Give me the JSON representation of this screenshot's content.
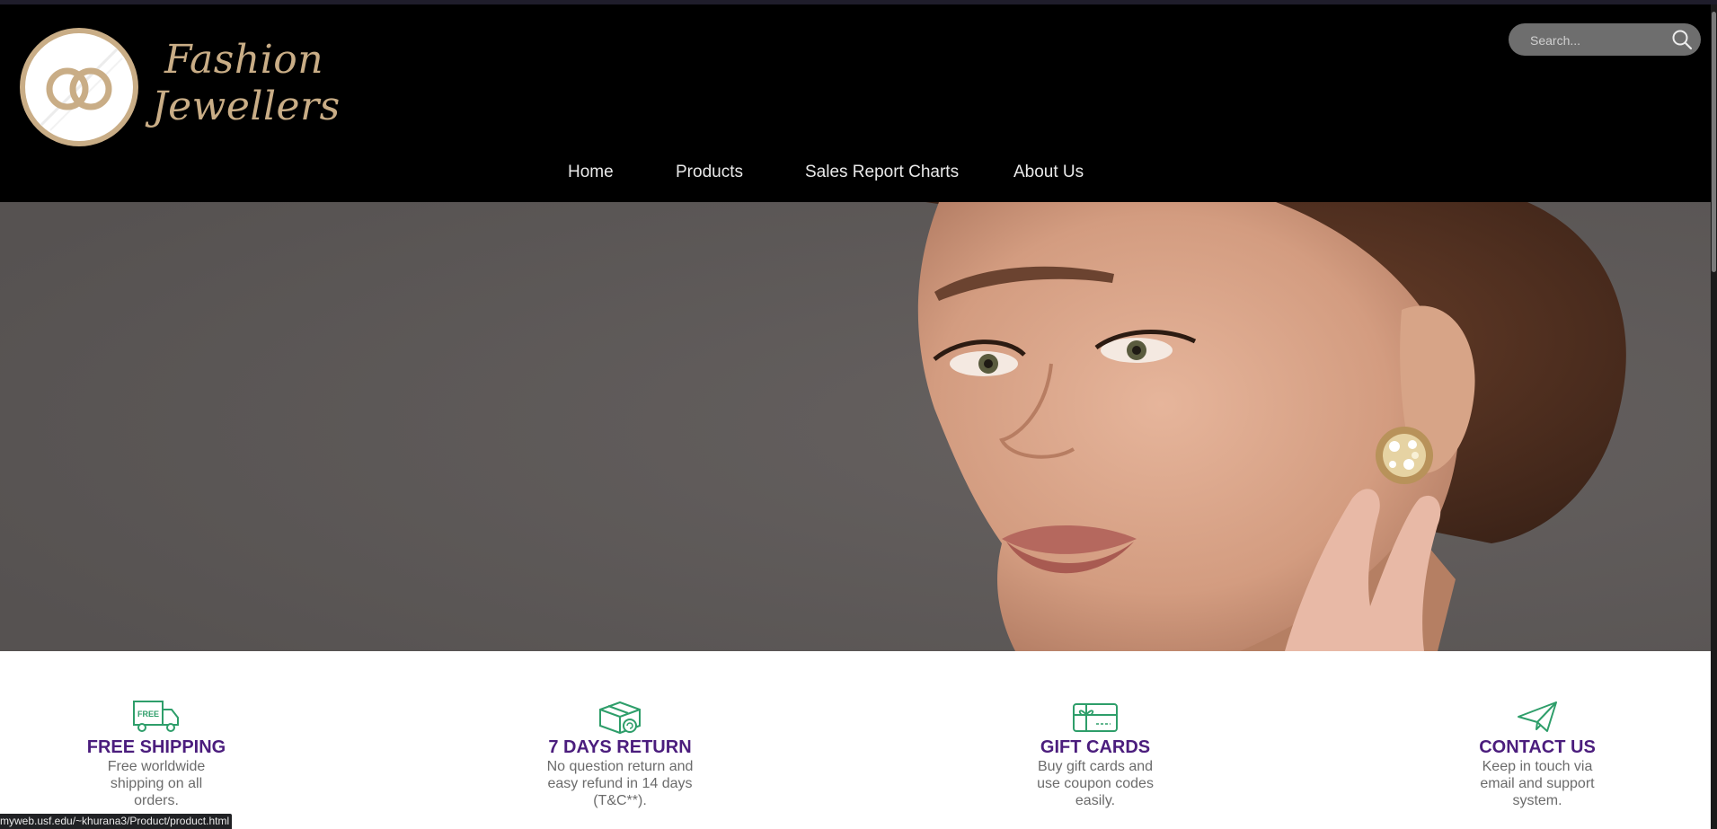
{
  "brand": {
    "line1": "Fashion",
    "line2": "Jewellers",
    "logo_icon": "interlocked-rings-icon",
    "accent_color": "#c9ad86"
  },
  "search": {
    "placeholder": "Search...",
    "icon": "search-icon"
  },
  "nav": {
    "items": [
      {
        "label": "Home"
      },
      {
        "label": "Products"
      },
      {
        "label": "Sales Report Charts"
      },
      {
        "label": "About Us"
      }
    ]
  },
  "features": [
    {
      "icon": "free-delivery-truck-icon",
      "icon_text": "FREE",
      "title": "FREE SHIPPING",
      "desc": "Free worldwide shipping on all orders."
    },
    {
      "icon": "return-box-icon",
      "title": "7 DAYS RETURN",
      "desc": "No question return and easy refund in 14 days (T&C**)."
    },
    {
      "icon": "gift-card-icon",
      "title": "GIFT CARDS",
      "desc": "Buy gift cards and use coupon codes easily."
    },
    {
      "icon": "paper-plane-icon",
      "title": "CONTACT US",
      "desc": "Keep in touch via email and support system."
    }
  ],
  "colors": {
    "header_bg": "#000000",
    "feature_title": "#4b1d7d",
    "feature_icon": "#2e9e6a",
    "hero_bg": "#5e5a59"
  },
  "status_bar": {
    "url": "myweb.usf.edu/~khurana3/Product/product.html"
  }
}
